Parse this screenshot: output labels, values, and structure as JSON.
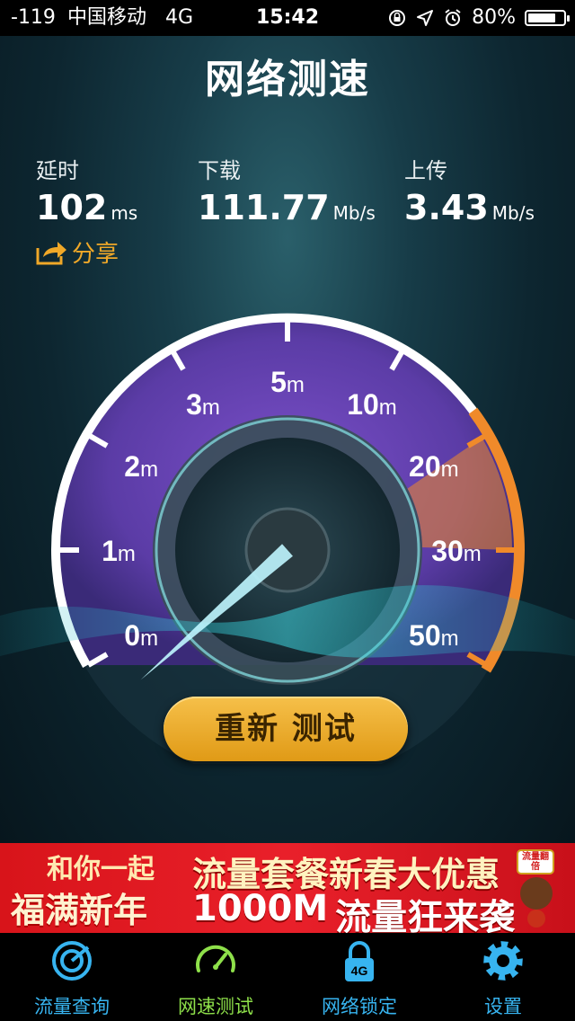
{
  "status_bar": {
    "signal": "-119",
    "carrier": "中国移动",
    "network": "4G",
    "time": "15:42",
    "battery": "80%",
    "battery_level": 0.8
  },
  "title": "网络测速",
  "stats": [
    {
      "label": "延时",
      "value": "102",
      "unit": "ms"
    },
    {
      "label": "下载",
      "value": "111.77",
      "unit": "Mb/s"
    },
    {
      "label": "上传",
      "value": "3.43",
      "unit": "Mb/s"
    }
  ],
  "share_label": "分享",
  "gauge": {
    "ticks": [
      {
        "num": "0",
        "unit": "m"
      },
      {
        "num": "1",
        "unit": "m"
      },
      {
        "num": "2",
        "unit": "m"
      },
      {
        "num": "3",
        "unit": "m"
      },
      {
        "num": "5",
        "unit": "m"
      },
      {
        "num": "10",
        "unit": "m"
      },
      {
        "num": "20",
        "unit": "m"
      },
      {
        "num": "30",
        "unit": "m"
      },
      {
        "num": "50",
        "unit": "m"
      }
    ],
    "accent_color": "#f08a2a",
    "needle_color": "#bff6ff"
  },
  "retest_button": "重新 测试",
  "banner": {
    "line1": "和你一起",
    "line2": "福满新年",
    "headline": "流量套餐新春大优惠",
    "amount": "1000M",
    "tagline": "流量狂来袭",
    "mascot_text": "流量翻倍"
  },
  "tabs": [
    {
      "label": "流量查询",
      "icon": "radar-icon",
      "active": false
    },
    {
      "label": "网速测试",
      "icon": "speedometer-icon",
      "active": true
    },
    {
      "label": "网络锁定",
      "icon": "lock-4g-icon",
      "badge": "4G",
      "active": false
    },
    {
      "label": "设置",
      "icon": "gear-icon",
      "active": false
    }
  ]
}
